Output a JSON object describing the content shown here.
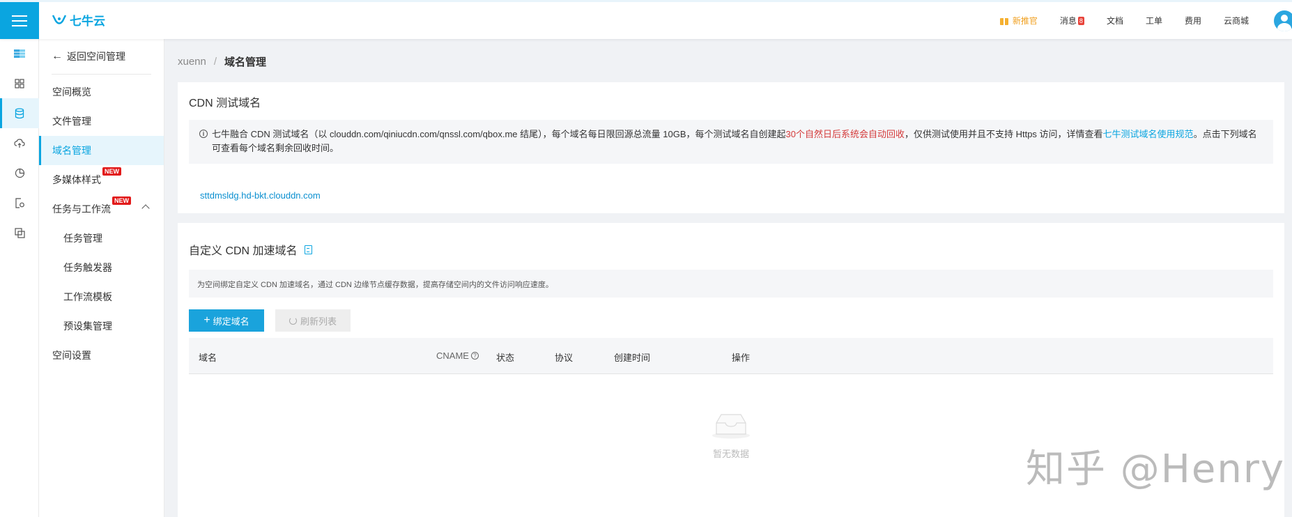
{
  "header": {
    "logo_text": "七牛云",
    "nav": {
      "promo": "新推官",
      "messages": "消息",
      "messages_count": "8",
      "docs": "文档",
      "tickets": "工单",
      "billing": "费用",
      "market": "云商城"
    }
  },
  "sidebar": {
    "rail_icons": [
      "bucket-icon",
      "apps-grid-icon",
      "database-icon",
      "cloud-upload-icon",
      "pie-chart-icon",
      "file-search-icon",
      "copy-icon"
    ],
    "back_label": "返回空间管理",
    "items": [
      {
        "label": "空间概览"
      },
      {
        "label": "文件管理"
      },
      {
        "label": "域名管理"
      },
      {
        "label": "多媒体样式",
        "badge": "NEW"
      },
      {
        "label": "任务与工作流",
        "badge": "NEW"
      },
      {
        "label": "任务管理"
      },
      {
        "label": "任务触发器"
      },
      {
        "label": "工作流模板"
      },
      {
        "label": "预设集管理"
      },
      {
        "label": "空间设置"
      }
    ]
  },
  "breadcrumb": {
    "parent": "xuenn",
    "separator": "/",
    "current": "域名管理"
  },
  "test_domain_card": {
    "title": "CDN 测试域名",
    "notice_part1": "七牛融合 CDN 测试域名（以 clouddn.com/qiniucdn.com/qnssl.com/qbox.me 结尾），每个域名每日限回源总流量 10GB，每个测试域名自创建起",
    "notice_red": "30个自然日后系统会自动回收",
    "notice_part2": "，仅供测试使用并且不支持 Https 访问，详情查看",
    "notice_link": "七牛测试域名使用规范",
    "notice_part3": "。点击下列域名可查看每个域名剩余回收时间。",
    "domain": "sttdmsldg.hd-bkt.clouddn.com"
  },
  "custom_domain_card": {
    "title": "自定义 CDN 加速域名",
    "description": "为空间绑定自定义 CDN 加速域名，通过 CDN 边缘节点缓存数据，提高存储空间内的文件访问响应速度。",
    "bind_button": "绑定域名",
    "refresh_button": "刷新列表",
    "columns": {
      "domain": "域名",
      "cname": "CNAME",
      "status": "状态",
      "protocol": "协议",
      "created": "创建时间",
      "actions": "操作"
    },
    "empty_text": "暂无数据"
  },
  "watermark": "知乎 @Henry",
  "colors": {
    "brand": "#0aa5e0",
    "warning_text": "#d43a3a",
    "promo": "#f0a020"
  }
}
